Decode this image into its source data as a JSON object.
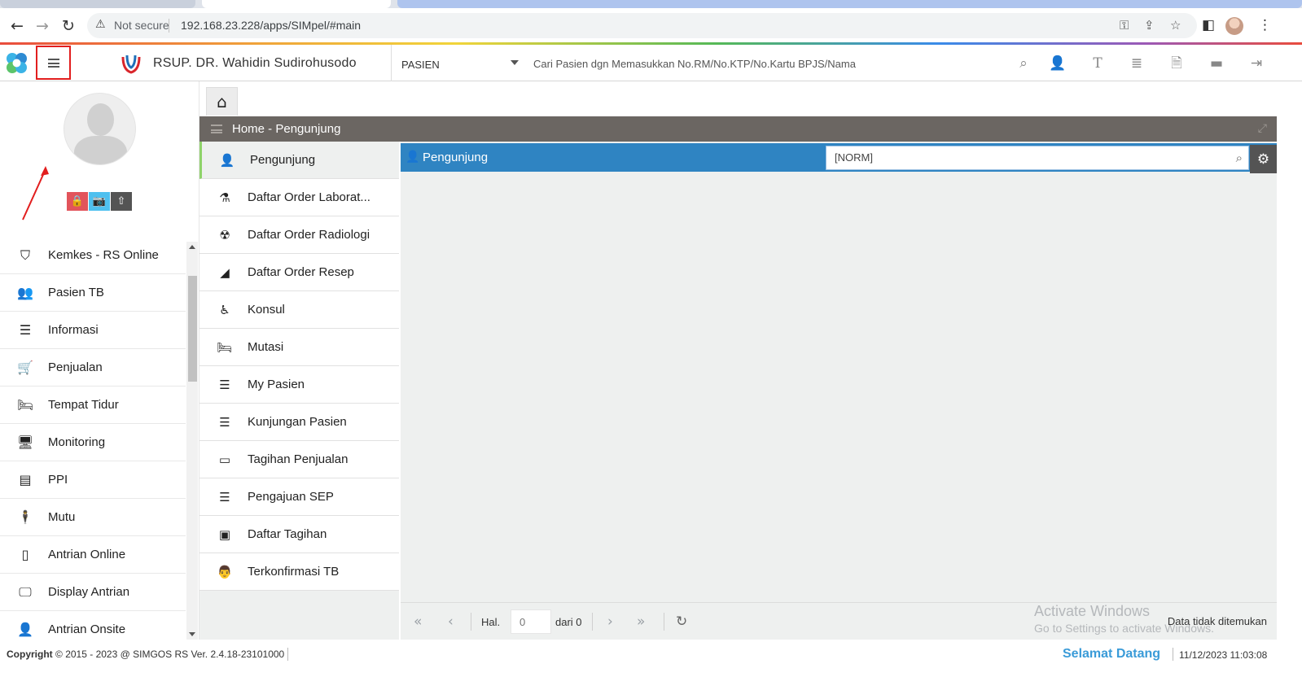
{
  "browser": {
    "security_label": "Not secure",
    "url": "192.168.23.228/apps/SIMpel/#main"
  },
  "header": {
    "hospital_name": "RSUP. DR. Wahidin Sudirohusodo",
    "search_type": "PASIEN",
    "search_placeholder": "Cari Pasien dgn Memasukkan No.RM/No.KTP/No.Kartu BPJS/Nama",
    "toolbar_icons": [
      "search-icon",
      "add-user-icon",
      "text-icon",
      "list-icon",
      "pdf-icon",
      "folder-icon",
      "sign-out-icon"
    ]
  },
  "sidebar": {
    "items": [
      {
        "label": "Kemkes - RS Online",
        "icon": "shield-icon"
      },
      {
        "label": "Pasien TB",
        "icon": "users-icon"
      },
      {
        "label": "Informasi",
        "icon": "info-list-icon"
      },
      {
        "label": "Penjualan",
        "icon": "cart-icon"
      },
      {
        "label": "Tempat Tidur",
        "icon": "bed-icon"
      },
      {
        "label": "Monitoring",
        "icon": "monitor-icon"
      },
      {
        "label": "PPI",
        "icon": "id-card-icon"
      },
      {
        "label": "Mutu",
        "icon": "person-icon"
      },
      {
        "label": "Antrian Online",
        "icon": "mobile-icon"
      },
      {
        "label": "Display Antrian",
        "icon": "display-icon"
      },
      {
        "label": "Antrian Onsite",
        "icon": "user-plus-icon"
      }
    ]
  },
  "panel": {
    "title": "Home - Pengunjung"
  },
  "submenu": {
    "items": [
      {
        "label": "Pengunjung",
        "icon": "user-icon",
        "active": true
      },
      {
        "label": "Daftar Order Laborat...",
        "icon": "flask-icon"
      },
      {
        "label": "Daftar Order Radiologi",
        "icon": "radiology-icon"
      },
      {
        "label": "Daftar Order Resep",
        "icon": "eraser-icon"
      },
      {
        "label": "Konsul",
        "icon": "wheelchair-icon"
      },
      {
        "label": "Mutasi",
        "icon": "bed-icon"
      },
      {
        "label": "My Pasien",
        "icon": "list-icon"
      },
      {
        "label": "Kunjungan Pasien",
        "icon": "list-icon"
      },
      {
        "label": "Tagihan Penjualan",
        "icon": "credit-card-icon"
      },
      {
        "label": "Pengajuan SEP",
        "icon": "list-icon"
      },
      {
        "label": "Daftar Tagihan",
        "icon": "money-icon"
      },
      {
        "label": "Terkonfirmasi TB",
        "icon": "user-md-icon"
      }
    ]
  },
  "content": {
    "title": "Pengunjung",
    "norm_placeholder": "[NORM]"
  },
  "pager": {
    "page_label": "Hal.",
    "page_value": "0",
    "of_label": "dari 0",
    "status": "Data tidak ditemukan"
  },
  "watermark": {
    "line1": "Activate Windows",
    "line2": "Go to Settings to activate Windows."
  },
  "footer": {
    "copyright_label": "Copyright",
    "copyright_text": "2015 - 2023 @ SIMGOS RS Ver. 2.4.18-23101000",
    "welcome": "Selamat Datang",
    "datetime": "11/12/2023 11:03:08"
  },
  "colors": {
    "accent_blue": "#2f84c2",
    "title_bar": "#6b6662",
    "active_indicator": "#8fd36a",
    "highlight_box": "#e21e1e"
  }
}
